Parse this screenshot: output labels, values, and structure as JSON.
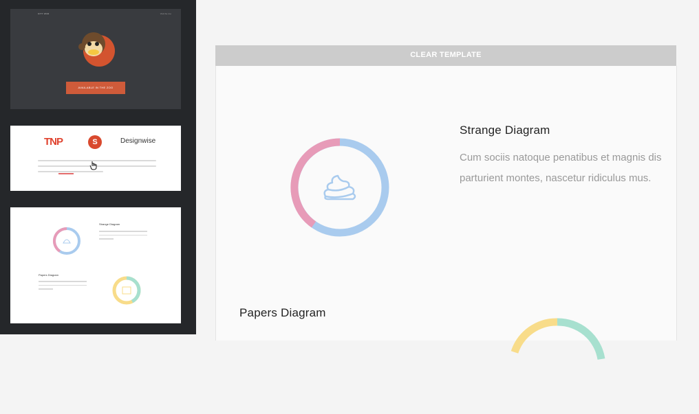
{
  "sidebar": {
    "thumb_hero": {
      "brand": "CITY ZOO",
      "nav": "Visit the zoo",
      "cta": "AVAILABLE IN THE ZOO"
    },
    "thumb_logos": {
      "tnp": "TNP",
      "s_logo": "S",
      "designwise": "Designwise"
    },
    "thumb_diagrams": {
      "title1": "Strange Diagram",
      "title2": "Papers Diagram"
    }
  },
  "toolbar": {
    "clear_label": "CLEAR TEMPLATE"
  },
  "main": {
    "section1": {
      "title": "Strange Diagram",
      "text": "Cum sociis natoque penatibus et magnis dis parturient montes, nascetur ridiculus mus."
    },
    "section2": {
      "title": "Papers Diagram"
    }
  },
  "colors": {
    "ring_blue": "#a9cbee",
    "ring_pink": "#e79bb8",
    "ring_yellow": "#f8dc8a",
    "ring_mint": "#a7e0cf",
    "accent": "#cf5b3a"
  },
  "icons": {
    "diagram1": "poop-icon",
    "diagram2": "paper-icon"
  }
}
